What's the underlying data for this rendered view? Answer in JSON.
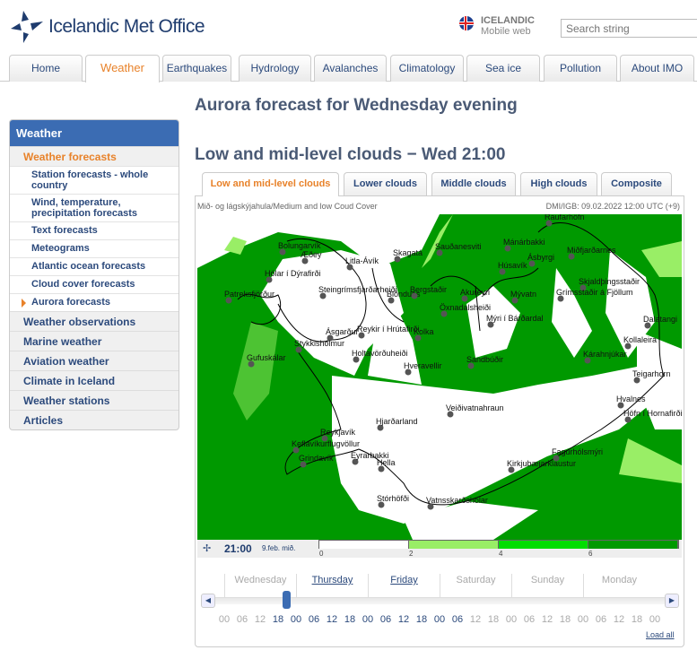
{
  "header": {
    "logo_text": "Icelandic Met Office",
    "language": "ICELANDIC",
    "mobile": "Mobile web",
    "search_placeholder": "Search string"
  },
  "nav": [
    {
      "label": "Home"
    },
    {
      "label": "Weather",
      "active": true
    },
    {
      "label": "Earthquakes"
    },
    {
      "label": "Hydrology"
    },
    {
      "label": "Avalanches"
    },
    {
      "label": "Climatology"
    },
    {
      "label": "Sea ice"
    },
    {
      "label": "Pollution"
    },
    {
      "label": "About IMO"
    }
  ],
  "sidebar": {
    "title": "Weather",
    "current_section": "Weather forecasts",
    "sub_items": [
      "Station forecasts - whole country",
      "Wind, temperature, precipitation forecasts",
      "Text forecasts",
      "Meteograms",
      "Atlantic ocean forecasts",
      "Cloud cover forecasts",
      "Aurora forecasts"
    ],
    "active_sub": "Aurora forecasts",
    "sections": [
      "Weather observations",
      "Marine weather",
      "Aviation weather",
      "Climate in Iceland",
      "Weather stations",
      "Articles"
    ]
  },
  "main": {
    "title": "Aurora forecast for Wednesday evening",
    "subtitle": "Low and mid-level clouds − Wed 21:00",
    "tabs": [
      {
        "label": "Low and mid-level clouds",
        "active": true
      },
      {
        "label": "Lower clouds"
      },
      {
        "label": "Middle clouds"
      },
      {
        "label": "High clouds"
      },
      {
        "label": "Composite"
      }
    ],
    "map_caption": "Mið- og lágskýjahula/Medium and low Coud Cover",
    "map_source": "DMI/IGB: 09.02.2022 12:00 UTC (+9)",
    "stations": [
      "Raufarhöfn",
      "Bolungarvík",
      "Æðey",
      "Litla-Ávík",
      "Skagatá",
      "Sauðanesviti",
      "Mánárbakki",
      "Miðfjarðarnes",
      "Ásbyrgi",
      "Húsavík",
      "Hólar í Dýrafirði",
      "Skjaldþingsstaðir",
      "Patreksfjörður",
      "Steingrímsfjarðarheiði",
      "Blönduós",
      "Bergstaðir",
      "Akureyri",
      "Mývatn",
      "Grímsstaðir á Fjöllum",
      "Öxnadalsheiði",
      "Mýri í Bárðardal",
      "Dalatangi",
      "Ásgarður",
      "Reykir í Hrútafirði",
      "Kolka",
      "Stykkishólmur",
      "Kollaleira",
      "Holtavörðuheiði",
      "Kárahnjúkar",
      "Gufuskálar",
      "Hveravellir",
      "Sandbúðir",
      "Teigarhorn",
      "Hvalnes",
      "Höfn í Hornafirði",
      "Veiðivatnahraun",
      "Hjarðarland",
      "Reykjavík",
      "Keflavíkurflugvöllur",
      "Grindavík",
      "Eyrarbakki",
      "Hella",
      "Fagurhólsmýri",
      "Kirkjubæjarklaustur",
      "Stórhöfði",
      "Vatnsskarðshólar"
    ],
    "time": "21:00",
    "date": "9.feb. mið.",
    "legend": {
      "ticks": [
        "0",
        "2",
        "4",
        "6"
      ],
      "colors": [
        "#ffffff",
        "#99ee66",
        "#00dd00",
        "#009900"
      ]
    },
    "days": [
      {
        "label": "Wednesday",
        "link": false
      },
      {
        "label": "Thursday",
        "link": true
      },
      {
        "label": "Friday",
        "link": true
      },
      {
        "label": "Saturday",
        "link": false
      },
      {
        "label": "Sunday",
        "link": false
      },
      {
        "label": "Monday",
        "link": false
      }
    ],
    "hours": [
      "00",
      "06",
      "12",
      "18",
      "00",
      "06",
      "12",
      "18",
      "00",
      "06",
      "12",
      "18",
      "00",
      "06",
      "12",
      "18",
      "00",
      "06",
      "12",
      "18",
      "00",
      "06",
      "12",
      "18",
      "00"
    ],
    "hours_available_from": 3,
    "hours_available_to": 13,
    "slider_position": "Wednesday 21:00",
    "load_all": "Load all"
  },
  "colors": {
    "accent": "#e8822a",
    "brand": "#3b6cb3",
    "cloud_dark": "#009900"
  }
}
